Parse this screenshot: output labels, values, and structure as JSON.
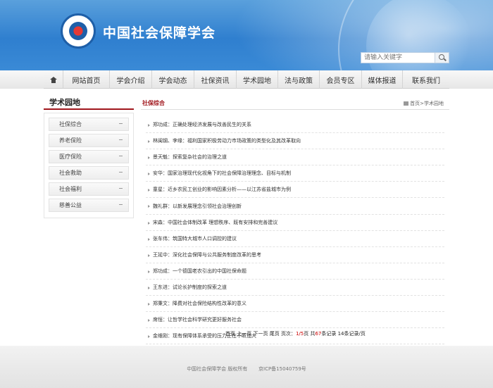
{
  "header": {
    "title": "中国社会保障学会",
    "search_placeholder": "请输入关键字"
  },
  "nav": {
    "items": [
      "网站首页",
      "学会介绍",
      "学会动态",
      "社保资讯",
      "学术园地",
      "法与政策",
      "会员专区",
      "媒体报道",
      "联系我们"
    ]
  },
  "sidebar": {
    "title": "学术园地",
    "items": [
      "社保综合",
      "养老保险",
      "医疗保险",
      "社会救助",
      "社会福利",
      "慈善公益"
    ]
  },
  "main": {
    "category": "社保综合",
    "breadcrumb_home": "首页",
    "breadcrumb_current": ">学术园地",
    "articles": [
      "郑功成：正确处理经济发展与改善民生的关系",
      "林闽钢、李缘：福利国家积极劳动力市场政策的类型化及其改革取向",
      "景天魁：探索复杂社会的治理之道",
      "安华：国家治理现代化视角下的社会保障治理理念、目标与机制",
      "童星：近乡农民工创业的影响因素分析——以江苏省盐城市为例",
      "魏礼群：以新发展理念引领社会治理创新",
      "宋森：中国社会体制改革 理想秩序、既有安排和完善建议",
      "张车伟：筑国特大城市人口调控的建议",
      "王延中：深化社会保障与公共服务制度改革的思考",
      "郑功成：一个德国老农引出的中国社保命题",
      "王东进：试论长护制度的探索之道",
      "郑秉文：降费对社会保险结构性改革的意义",
      "席恒：让哲学社会科学研究更好服务社会",
      "金维刚：现有保障体系承受的压力正在不断加大"
    ],
    "pager": {
      "first": "首页",
      "prev": "上一页",
      "next": "下一页",
      "last": "尾页",
      "page_label": "页次：",
      "page_value": "1/5",
      "page_unit": "页",
      "total_pre": "共",
      "total_value": "67",
      "total_unit": "条记录",
      "per_page": "14",
      "per_page_unit": "条记录/页"
    }
  },
  "footer": {
    "copyright": "中国社会保障学会 版权所有",
    "icp": "京ICP备15040759号"
  },
  "colors": {
    "accent_red": "#a0161c",
    "banner_blue": "#2f7fcf"
  }
}
